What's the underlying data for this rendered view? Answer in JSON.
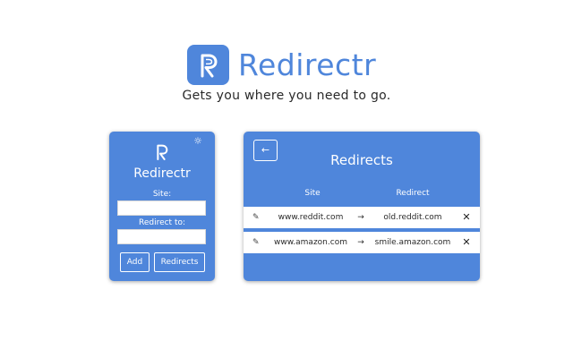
{
  "header": {
    "title": "Redirectr",
    "tagline": "Gets you where you need to go.",
    "logo_icon": "redirectr-r-logo-icon"
  },
  "popup": {
    "title": "Redirectr",
    "settings_icon": "☼",
    "site_label": "Site:",
    "site_value": "",
    "redirect_label": "Redirect to:",
    "redirect_value": "",
    "add_label": "Add",
    "redirects_label": "Redirects"
  },
  "panel": {
    "back_icon": "←",
    "title": "Redirects",
    "columns": [
      "Site",
      "Redirect"
    ],
    "rows": [
      {
        "edit_icon": "✎",
        "site": "www.reddit.com",
        "arrow": "→",
        "redirect": "old.reddit.com",
        "delete_icon": "✕"
      },
      {
        "edit_icon": "✎",
        "site": "www.amazon.com",
        "arrow": "→",
        "redirect": "smile.amazon.com",
        "delete_icon": "✕"
      }
    ]
  },
  "colors": {
    "brand": "#4f86db",
    "text": "#2a2a2a",
    "panel_text": "#ffffff"
  }
}
